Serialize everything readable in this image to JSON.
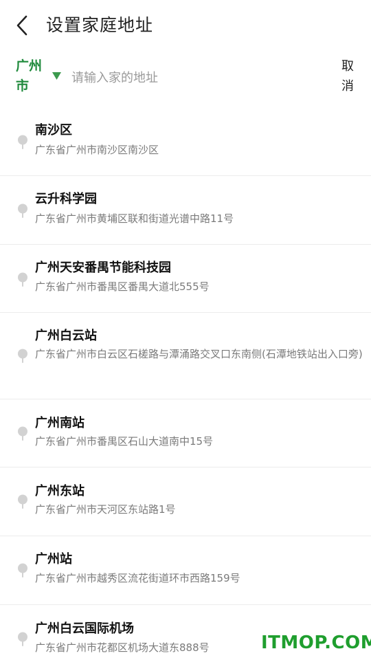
{
  "header": {
    "title": "设置家庭地址",
    "back_icon": "chevron-left-icon"
  },
  "search": {
    "city": "广州市",
    "placeholder": "请输入家的地址",
    "value": "",
    "cancel_label": "取消",
    "accent_color": "#1f8a3c"
  },
  "results": [
    {
      "name": "南沙区",
      "address": "广东省广州市南沙区南沙区"
    },
    {
      "name": "云升科学园",
      "address": "广东省广州市黄埔区联和街道光谱中路11号"
    },
    {
      "name": "广州天安番禺节能科技园",
      "address": "广东省广州市番禺区番禺大道北555号"
    },
    {
      "name": "广州白云站",
      "address": "广东省广州市白云区石槎路与潭涌路交叉口东南侧(石潭地铁站出入口旁)"
    },
    {
      "name": "广州南站",
      "address": "广东省广州市番禺区石山大道南中15号"
    },
    {
      "name": "广州东站",
      "address": "广东省广州市天河区东站路1号"
    },
    {
      "name": "广州站",
      "address": "广东省广州市越秀区流花街道环市西路159号"
    },
    {
      "name": "广州白云国际机场",
      "address": "广东省广州市花都区机场大道东888号"
    }
  ],
  "watermark": "ITMOP.COM"
}
